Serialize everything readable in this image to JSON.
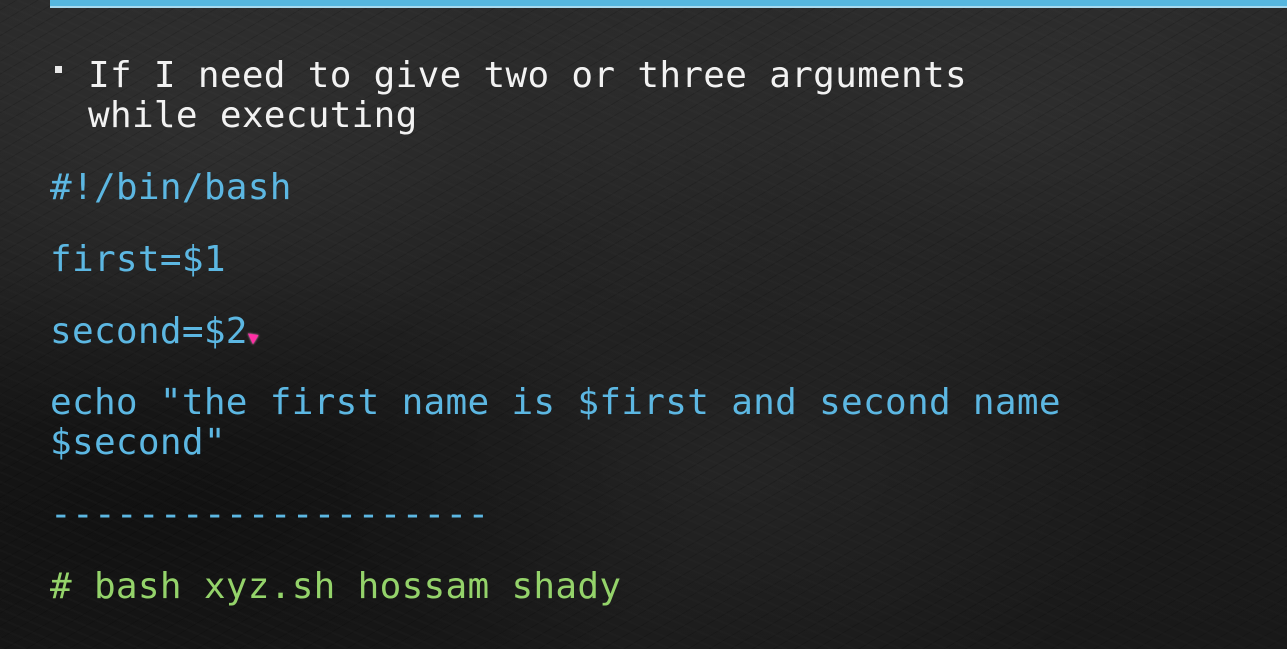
{
  "slide": {
    "bullet_line_1": "If I need to give two or three arguments",
    "bullet_line_2": "while executing",
    "code_lines": [
      "#!/bin/bash",
      "first=$1",
      "second=$2",
      "echo \"the first name is $first and second name",
      "$second\"",
      "--------------------",
      "# bash xyz.sh hossam shady"
    ]
  },
  "colors": {
    "accent": "#56b7df",
    "code_blue": "#5cb7e2",
    "command_green": "#94d36a",
    "text_white": "#f2f2f2",
    "pointer": "#ff2fa5"
  },
  "icons": {
    "bullet": "square-bullet-icon",
    "pointer": "pointer-icon"
  }
}
